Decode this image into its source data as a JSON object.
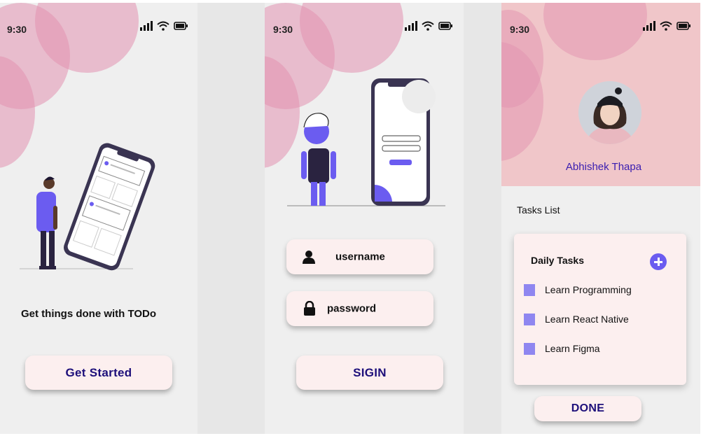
{
  "status_time": "9:30",
  "colors": {
    "accent": "#6b5cf0",
    "button_text": "#1d0f7a",
    "blob": "#e292b0",
    "header": "#f0c6c9"
  },
  "icons": [
    "cellular-signal-icon",
    "wifi-icon",
    "battery-icon",
    "user-icon",
    "lock-icon",
    "plus-icon"
  ],
  "welcome": {
    "tagline": "Get things done with TODo",
    "start_button": "Get Started"
  },
  "login": {
    "username_label": "username",
    "password_label": "password",
    "signin_button": "SIGIN"
  },
  "tasks_screen": {
    "user_name": "Abhishek Thapa",
    "list_title": "Tasks List",
    "card_title": "Daily Tasks",
    "tasks": [
      "Learn Programming",
      "Learn React Native",
      "Learn Figma"
    ],
    "done_button": "DONE"
  }
}
